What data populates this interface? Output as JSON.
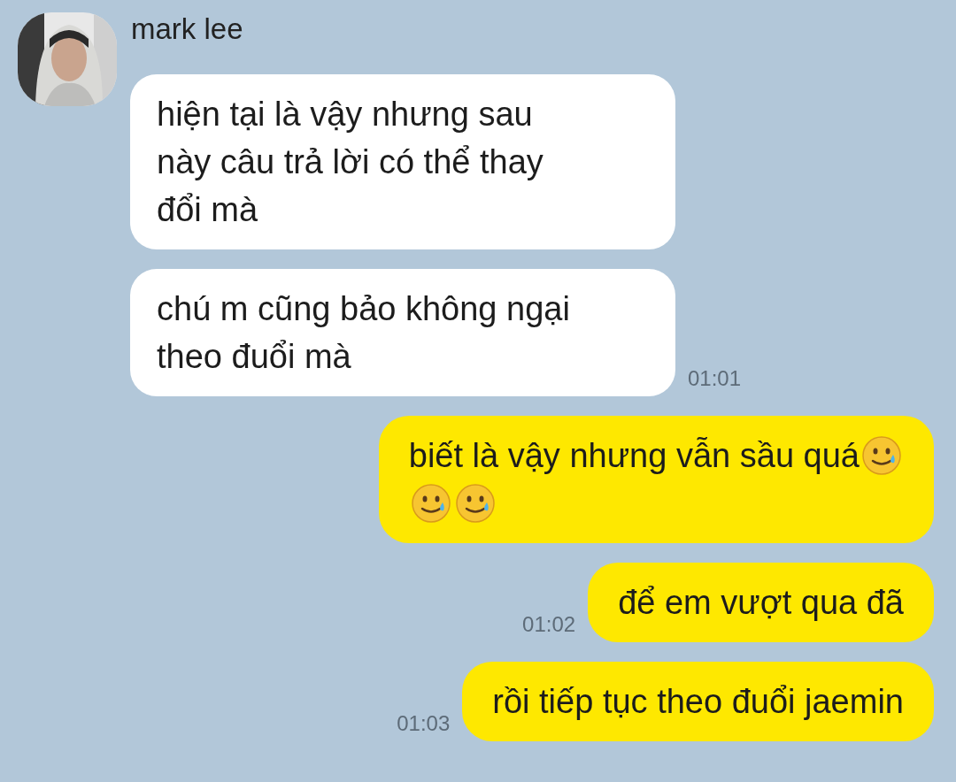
{
  "contact": {
    "name": "mark lee"
  },
  "messages": [
    {
      "kind": "received",
      "lines": [
        {
          "text": "hiện tại là vậy nhưng sau"
        },
        {
          "text": "này câu trả lời có thể thay"
        },
        {
          "text": "đổi mà"
        }
      ]
    },
    {
      "kind": "received",
      "lines": [
        {
          "text": "chú m cũng bảo không ngại"
        },
        {
          "text": "theo đuổi mà"
        }
      ],
      "time": "01:01"
    },
    {
      "kind": "sent",
      "lines": [
        {
          "text": "biết là vậy nhưng vẫn sầu quá",
          "emojis": [
            {
              "kind": "smile-tear"
            }
          ]
        },
        {
          "emojis": [
            {
              "kind": "smile-tear"
            },
            {
              "kind": "smile-tear"
            }
          ]
        }
      ]
    },
    {
      "kind": "sent",
      "lines": [
        {
          "text": "để em vượt qua đã"
        }
      ],
      "time": "01:02"
    },
    {
      "kind": "sent",
      "lines": [
        {
          "text": "rồi tiếp tục theo đuổi jaemin"
        }
      ],
      "time": "01:03"
    }
  ]
}
